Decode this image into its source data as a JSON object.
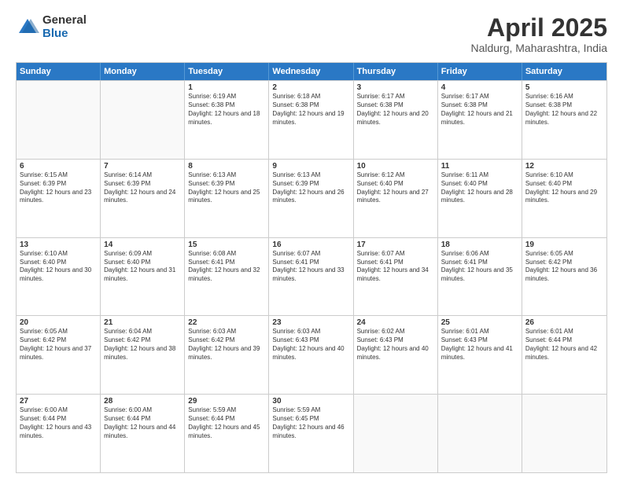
{
  "header": {
    "logo": {
      "general": "General",
      "blue": "Blue"
    },
    "title": "April 2025",
    "location": "Naldurg, Maharashtra, India"
  },
  "calendar": {
    "days_of_week": [
      "Sunday",
      "Monday",
      "Tuesday",
      "Wednesday",
      "Thursday",
      "Friday",
      "Saturday"
    ],
    "weeks": [
      [
        {
          "day": null,
          "sunrise": null,
          "sunset": null,
          "daylight": null
        },
        {
          "day": null,
          "sunrise": null,
          "sunset": null,
          "daylight": null
        },
        {
          "day": 1,
          "sunrise": "Sunrise: 6:19 AM",
          "sunset": "Sunset: 6:38 PM",
          "daylight": "Daylight: 12 hours and 18 minutes."
        },
        {
          "day": 2,
          "sunrise": "Sunrise: 6:18 AM",
          "sunset": "Sunset: 6:38 PM",
          "daylight": "Daylight: 12 hours and 19 minutes."
        },
        {
          "day": 3,
          "sunrise": "Sunrise: 6:17 AM",
          "sunset": "Sunset: 6:38 PM",
          "daylight": "Daylight: 12 hours and 20 minutes."
        },
        {
          "day": 4,
          "sunrise": "Sunrise: 6:17 AM",
          "sunset": "Sunset: 6:38 PM",
          "daylight": "Daylight: 12 hours and 21 minutes."
        },
        {
          "day": 5,
          "sunrise": "Sunrise: 6:16 AM",
          "sunset": "Sunset: 6:38 PM",
          "daylight": "Daylight: 12 hours and 22 minutes."
        }
      ],
      [
        {
          "day": 6,
          "sunrise": "Sunrise: 6:15 AM",
          "sunset": "Sunset: 6:39 PM",
          "daylight": "Daylight: 12 hours and 23 minutes."
        },
        {
          "day": 7,
          "sunrise": "Sunrise: 6:14 AM",
          "sunset": "Sunset: 6:39 PM",
          "daylight": "Daylight: 12 hours and 24 minutes."
        },
        {
          "day": 8,
          "sunrise": "Sunrise: 6:13 AM",
          "sunset": "Sunset: 6:39 PM",
          "daylight": "Daylight: 12 hours and 25 minutes."
        },
        {
          "day": 9,
          "sunrise": "Sunrise: 6:13 AM",
          "sunset": "Sunset: 6:39 PM",
          "daylight": "Daylight: 12 hours and 26 minutes."
        },
        {
          "day": 10,
          "sunrise": "Sunrise: 6:12 AM",
          "sunset": "Sunset: 6:40 PM",
          "daylight": "Daylight: 12 hours and 27 minutes."
        },
        {
          "day": 11,
          "sunrise": "Sunrise: 6:11 AM",
          "sunset": "Sunset: 6:40 PM",
          "daylight": "Daylight: 12 hours and 28 minutes."
        },
        {
          "day": 12,
          "sunrise": "Sunrise: 6:10 AM",
          "sunset": "Sunset: 6:40 PM",
          "daylight": "Daylight: 12 hours and 29 minutes."
        }
      ],
      [
        {
          "day": 13,
          "sunrise": "Sunrise: 6:10 AM",
          "sunset": "Sunset: 6:40 PM",
          "daylight": "Daylight: 12 hours and 30 minutes."
        },
        {
          "day": 14,
          "sunrise": "Sunrise: 6:09 AM",
          "sunset": "Sunset: 6:40 PM",
          "daylight": "Daylight: 12 hours and 31 minutes."
        },
        {
          "day": 15,
          "sunrise": "Sunrise: 6:08 AM",
          "sunset": "Sunset: 6:41 PM",
          "daylight": "Daylight: 12 hours and 32 minutes."
        },
        {
          "day": 16,
          "sunrise": "Sunrise: 6:07 AM",
          "sunset": "Sunset: 6:41 PM",
          "daylight": "Daylight: 12 hours and 33 minutes."
        },
        {
          "day": 17,
          "sunrise": "Sunrise: 6:07 AM",
          "sunset": "Sunset: 6:41 PM",
          "daylight": "Daylight: 12 hours and 34 minutes."
        },
        {
          "day": 18,
          "sunrise": "Sunrise: 6:06 AM",
          "sunset": "Sunset: 6:41 PM",
          "daylight": "Daylight: 12 hours and 35 minutes."
        },
        {
          "day": 19,
          "sunrise": "Sunrise: 6:05 AM",
          "sunset": "Sunset: 6:42 PM",
          "daylight": "Daylight: 12 hours and 36 minutes."
        }
      ],
      [
        {
          "day": 20,
          "sunrise": "Sunrise: 6:05 AM",
          "sunset": "Sunset: 6:42 PM",
          "daylight": "Daylight: 12 hours and 37 minutes."
        },
        {
          "day": 21,
          "sunrise": "Sunrise: 6:04 AM",
          "sunset": "Sunset: 6:42 PM",
          "daylight": "Daylight: 12 hours and 38 minutes."
        },
        {
          "day": 22,
          "sunrise": "Sunrise: 6:03 AM",
          "sunset": "Sunset: 6:42 PM",
          "daylight": "Daylight: 12 hours and 39 minutes."
        },
        {
          "day": 23,
          "sunrise": "Sunrise: 6:03 AM",
          "sunset": "Sunset: 6:43 PM",
          "daylight": "Daylight: 12 hours and 40 minutes."
        },
        {
          "day": 24,
          "sunrise": "Sunrise: 6:02 AM",
          "sunset": "Sunset: 6:43 PM",
          "daylight": "Daylight: 12 hours and 40 minutes."
        },
        {
          "day": 25,
          "sunrise": "Sunrise: 6:01 AM",
          "sunset": "Sunset: 6:43 PM",
          "daylight": "Daylight: 12 hours and 41 minutes."
        },
        {
          "day": 26,
          "sunrise": "Sunrise: 6:01 AM",
          "sunset": "Sunset: 6:44 PM",
          "daylight": "Daylight: 12 hours and 42 minutes."
        }
      ],
      [
        {
          "day": 27,
          "sunrise": "Sunrise: 6:00 AM",
          "sunset": "Sunset: 6:44 PM",
          "daylight": "Daylight: 12 hours and 43 minutes."
        },
        {
          "day": 28,
          "sunrise": "Sunrise: 6:00 AM",
          "sunset": "Sunset: 6:44 PM",
          "daylight": "Daylight: 12 hours and 44 minutes."
        },
        {
          "day": 29,
          "sunrise": "Sunrise: 5:59 AM",
          "sunset": "Sunset: 6:44 PM",
          "daylight": "Daylight: 12 hours and 45 minutes."
        },
        {
          "day": 30,
          "sunrise": "Sunrise: 5:59 AM",
          "sunset": "Sunset: 6:45 PM",
          "daylight": "Daylight: 12 hours and 46 minutes."
        },
        {
          "day": null,
          "sunrise": null,
          "sunset": null,
          "daylight": null
        },
        {
          "day": null,
          "sunrise": null,
          "sunset": null,
          "daylight": null
        },
        {
          "day": null,
          "sunrise": null,
          "sunset": null,
          "daylight": null
        }
      ]
    ]
  }
}
